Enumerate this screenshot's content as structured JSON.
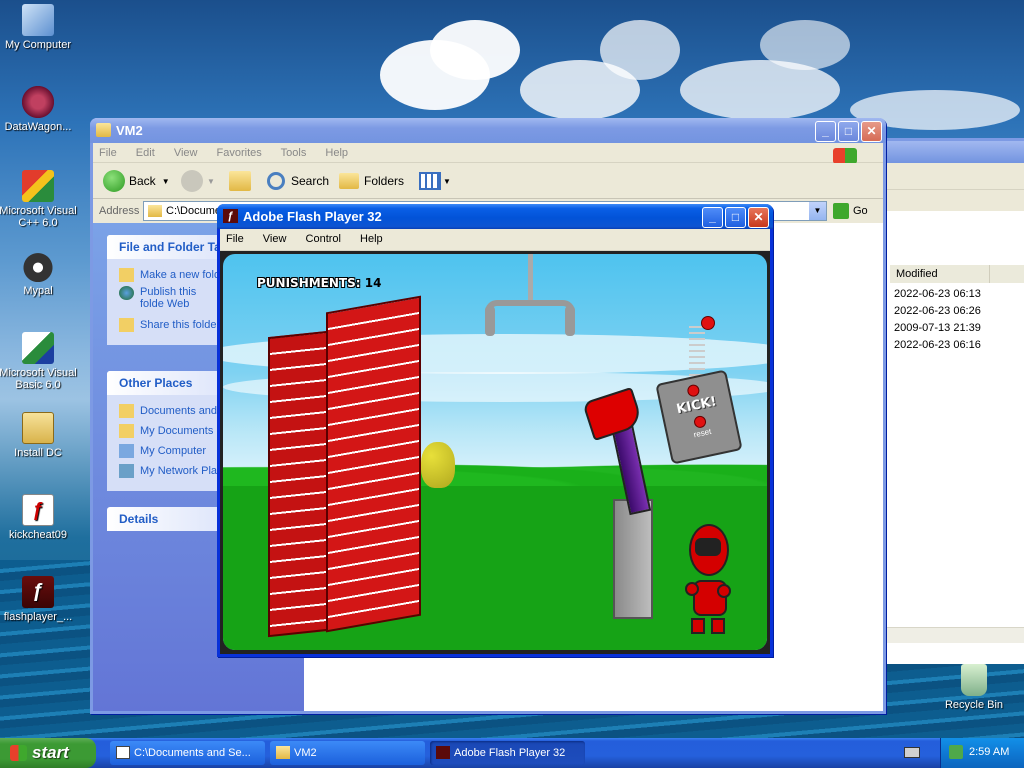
{
  "desktop": {
    "icons": [
      {
        "label": "My Computer",
        "icon": "my-computer-icon"
      },
      {
        "label": "DataWagon...",
        "icon": "datawagon-icon"
      },
      {
        "label": "Microsoft Visual C++ 6.0",
        "icon": "visual-cpp-icon"
      },
      {
        "label": "Mypal",
        "icon": "mypal-icon"
      },
      {
        "label": "Microsoft Visual Basic 6.0",
        "icon": "visual-basic-icon"
      },
      {
        "label": "Install DC",
        "icon": "install-dc-icon"
      },
      {
        "label": "kickcheat09",
        "icon": "swf-file-icon"
      },
      {
        "label": "flashplayer_...",
        "icon": "flash-player-icon"
      }
    ],
    "recycle_bin": "Recycle Bin"
  },
  "explorer": {
    "title": "VM2",
    "menu": [
      "File",
      "Edit",
      "View",
      "Favorites",
      "Tools",
      "Help"
    ],
    "toolbar": {
      "back": "Back",
      "search": "Search",
      "folders": "Folders"
    },
    "address_label": "Address",
    "address_value": "C:\\Docume",
    "go_label": "Go",
    "tasks_title": "File and Folder Ta",
    "tasks": [
      "Make a new fold",
      "Publish this folde Web",
      "Share this folde"
    ],
    "other_title": "Other Places",
    "places": [
      "Documents and",
      "My Documents",
      "My Computer",
      "My Network Plac"
    ],
    "details_title": "Details"
  },
  "back_window": {
    "column_header": "Modified",
    "rows": [
      "2022-06-23 06:13",
      "2022-06-23 06:26",
      "2009-07-13 21:39",
      "2022-06-23 06:16"
    ]
  },
  "flash": {
    "title": "Adobe Flash Player 32",
    "menu": [
      "File",
      "View",
      "Control",
      "Help"
    ],
    "game": {
      "punishments_label": "PUNISHMENTS:",
      "punishments_value": "14",
      "kick_label": "KICK!",
      "reset_label": "reset"
    }
  },
  "taskbar": {
    "start_label": "start",
    "tasks": [
      {
        "label": "C:\\Documents and Se...",
        "icon": "7zip-icon"
      },
      {
        "label": "VM2",
        "icon": "folder-icon"
      },
      {
        "label": "Adobe Flash Player 32",
        "icon": "flash-player-icon"
      }
    ],
    "clock": "2:59 AM"
  },
  "colors": {
    "xp_blue": "#0a5fe6",
    "taskbar_blue": "#245edb",
    "start_green": "#3c9a34",
    "game_wall_red": "#b00f0f",
    "game_grass": "#1aa81a"
  }
}
